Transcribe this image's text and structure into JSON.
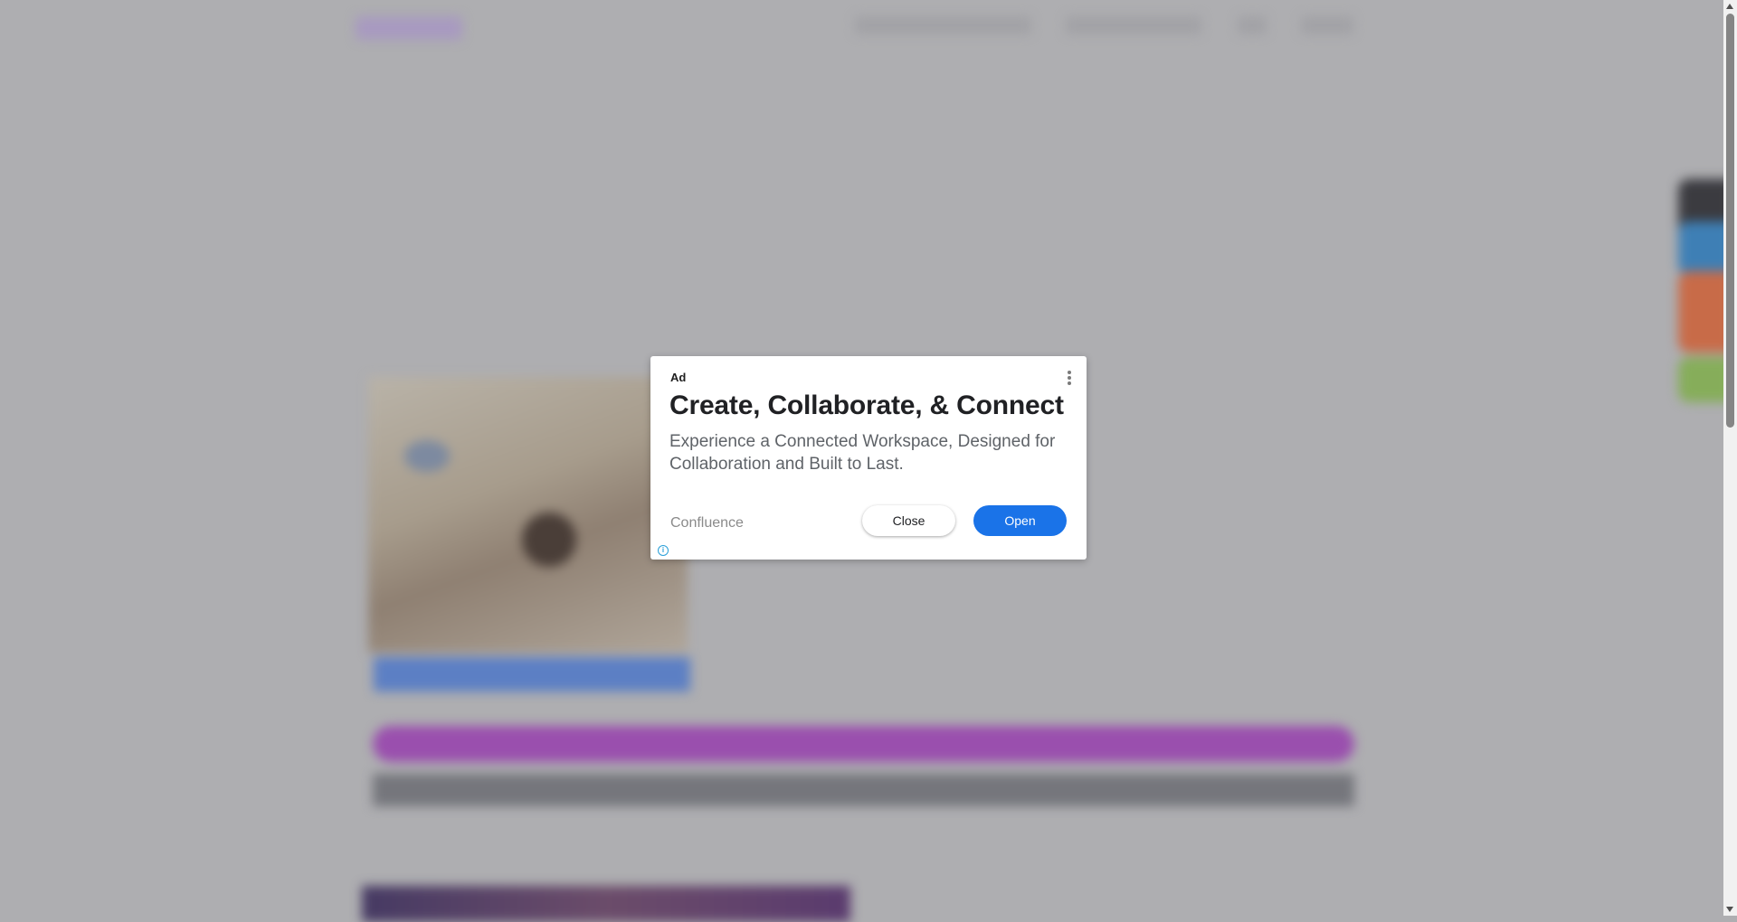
{
  "ad": {
    "label": "Ad",
    "headline": "Create, Collaborate, & Connect",
    "body": "Experience a Connected Workspace, Designed for Collaboration and Built to Last.",
    "advertiser": "Confluence",
    "close_label": "Close",
    "open_label": "Open",
    "info_glyph": "i"
  },
  "colors": {
    "open_button": "#1a73e8",
    "overlay": "#aeaeb1"
  },
  "icons": {
    "menu": "more-vert-icon",
    "info": "info-icon"
  }
}
